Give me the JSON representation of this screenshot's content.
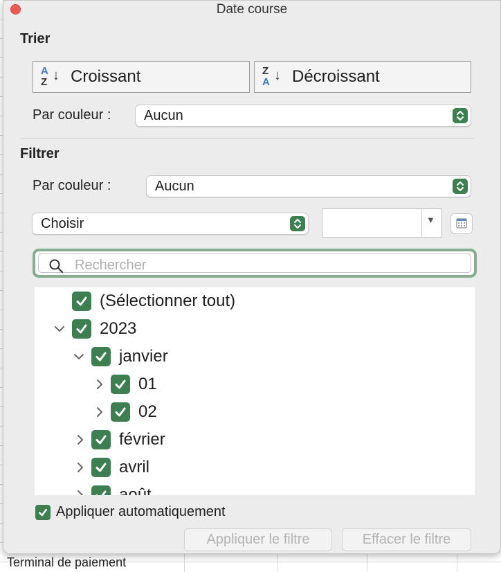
{
  "window": {
    "title": "Date course"
  },
  "background": {
    "footer_text": "Terminal de paiement"
  },
  "sort": {
    "section_label": "Trier",
    "ascending": {
      "label": "Croissant",
      "icon_top": "A",
      "icon_bottom": "Z"
    },
    "descending": {
      "label": "Décroissant",
      "icon_top": "Z",
      "icon_bottom": "A"
    },
    "by_color_label": "Par couleur :",
    "by_color_value": "Aucun"
  },
  "filter": {
    "section_label": "Filtrer",
    "by_color_label": "Par couleur :",
    "by_color_value": "Aucun",
    "condition_value": "Choisir",
    "condition_input_value": "",
    "search_placeholder": "Rechercher"
  },
  "tree": {
    "items": [
      {
        "label": "(Sélectionner tout)",
        "checked": true,
        "expander": "none"
      },
      {
        "label": "2023",
        "checked": true,
        "expander": "expanded"
      },
      {
        "label": "janvier",
        "checked": true,
        "expander": "expanded"
      },
      {
        "label": "01",
        "checked": true,
        "expander": "collapsed"
      },
      {
        "label": "02",
        "checked": true,
        "expander": "collapsed"
      },
      {
        "label": "février",
        "checked": true,
        "expander": "collapsed"
      },
      {
        "label": "avril",
        "checked": true,
        "expander": "collapsed"
      },
      {
        "label": "août",
        "checked": true,
        "expander": "collapsed"
      }
    ]
  },
  "auto_apply": {
    "label": "Appliquer automatiquement",
    "checked": true
  },
  "buttons": {
    "apply": "Appliquer le filtre",
    "clear": "Effacer le filtre"
  },
  "colors": {
    "accent_green": "#3e7f52",
    "focus_ring": "#86ae8e",
    "close_red": "#ed5b57"
  }
}
